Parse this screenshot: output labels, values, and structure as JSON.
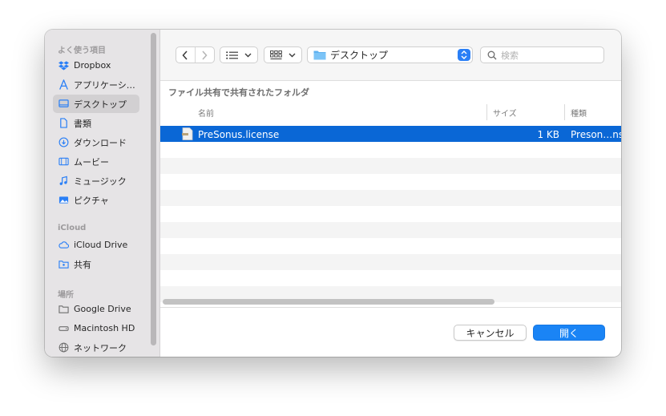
{
  "sidebar": {
    "favorites_label": "よく使う項目",
    "icloud_label": "iCloud",
    "locations_label": "場所",
    "items": [
      {
        "label": "Dropbox",
        "icon": "dropbox-icon"
      },
      {
        "label": "アプリケーシ…",
        "icon": "applications-icon"
      },
      {
        "label": "デスクトップ",
        "icon": "desktop-icon"
      },
      {
        "label": "書類",
        "icon": "document-icon"
      },
      {
        "label": "ダウンロード",
        "icon": "download-icon"
      },
      {
        "label": "ムービー",
        "icon": "film-icon"
      },
      {
        "label": "ミュージック",
        "icon": "music-note-icon"
      },
      {
        "label": "ピクチャ",
        "icon": "photo-icon"
      },
      {
        "label": "iCloud Drive",
        "icon": "cloud-icon"
      },
      {
        "label": "共有",
        "icon": "shared-folder-icon"
      },
      {
        "label": "Google Drive",
        "icon": "folder-icon"
      },
      {
        "label": "Macintosh HD",
        "icon": "drive-icon"
      },
      {
        "label": "ネットワーク",
        "icon": "globe-icon"
      }
    ],
    "selected": "デスクトップ"
  },
  "toolbar": {
    "location": "デスクトップ",
    "search_placeholder": "検索"
  },
  "main": {
    "enabled_label": "ファイル共有で共有されたフォルダ",
    "columns": [
      "名前",
      "サイズ",
      "種類"
    ],
    "files": [
      {
        "name": "PreSonus.license",
        "size": "1 KB",
        "kind": "Preson…ns"
      }
    ]
  },
  "footer": {
    "cancel_label": "キャンセル",
    "open_label": "開く"
  },
  "colors": {
    "accent": "#1a84f5",
    "selection": "#0a67d6",
    "sidebar_bg": "#e6e4e6"
  }
}
